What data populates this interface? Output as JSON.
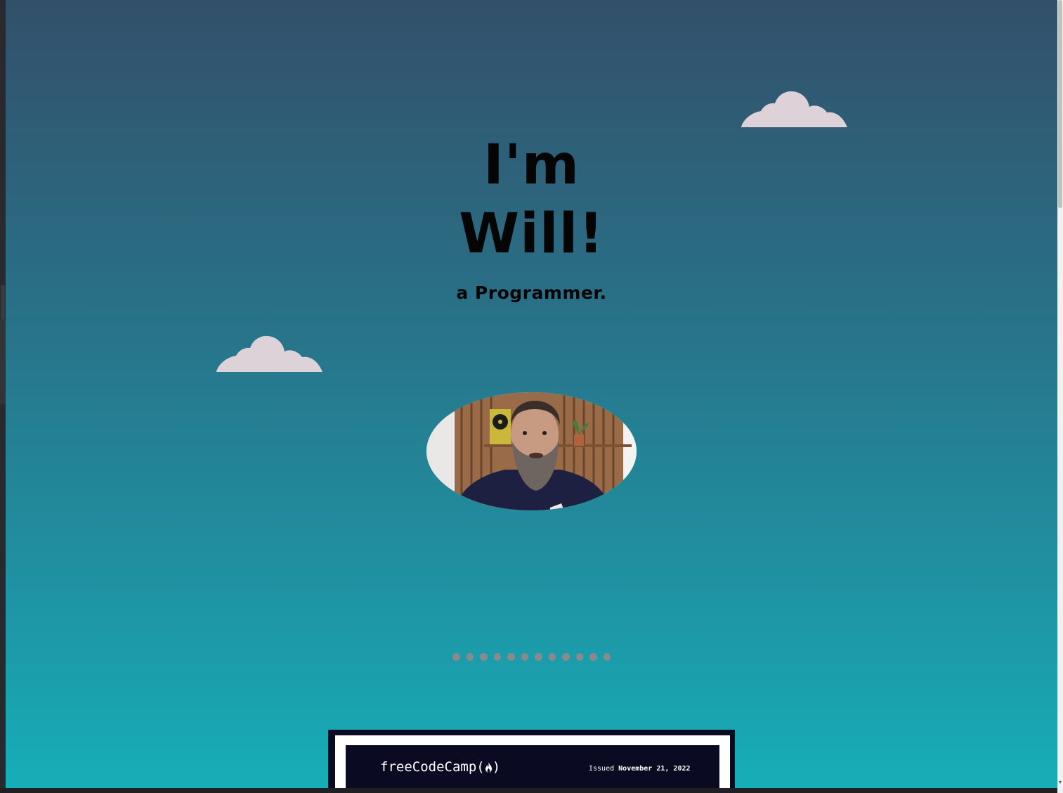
{
  "hero": {
    "title_line1": "I'm",
    "title_line2": "Will!",
    "tagline": "a Programmer."
  },
  "carousel": {
    "dot_count": 12
  },
  "certificate": {
    "logo_text": "freeCodeCamp(",
    "logo_close": ")",
    "issued_label": "Issued",
    "issued_date": "November 21, 2022"
  },
  "colors": {
    "sky_top": "#33506a",
    "sky_bottom": "#16aeb8",
    "cloud": "#dcd2d8",
    "dot": "#8a8a8e",
    "cert_dark": "#0a0a23"
  },
  "icons": {
    "cloud": "cloud-icon",
    "flame": "flame-icon"
  }
}
